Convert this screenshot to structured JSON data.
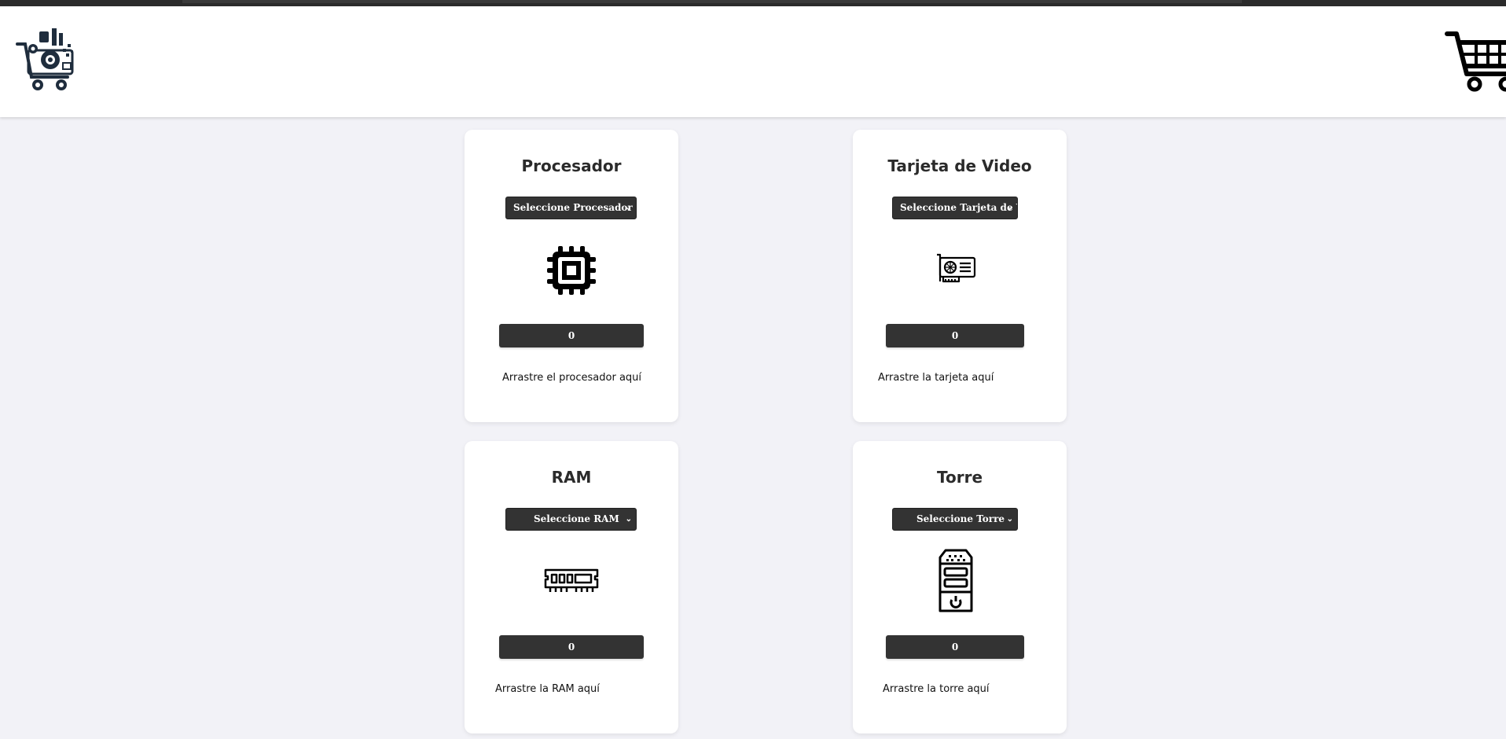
{
  "header": {
    "logo_icon": "shopping-cart-with-pc-parts-logo",
    "cart_icon": "shopping-cart-icon"
  },
  "cards": [
    {
      "title": "Procesador",
      "select_value": "Seleccione Procesador",
      "icon": "cpu-chip-icon",
      "quantity": "0",
      "drop_text": "Arrastre el procesador aquí"
    },
    {
      "title": "Tarjeta de Video",
      "select_value": "Seleccione Tarjeta de Video",
      "icon": "graphics-card-icon",
      "quantity": "0",
      "drop_text": "Arrastre la tarjeta aquí"
    },
    {
      "title": "RAM",
      "select_value": "Seleccione RAM",
      "icon": "ram-module-icon",
      "quantity": "0",
      "drop_text": "Arrastre la RAM aquí"
    },
    {
      "title": "Torre",
      "select_value": "Seleccione Torre",
      "icon": "pc-tower-icon",
      "quantity": "0",
      "drop_text": "Arrastre la torre aquí"
    }
  ],
  "colors": {
    "background": "#f2f2f7",
    "card": "#ffffff",
    "control": "#333333",
    "control_text": "#ffffff"
  }
}
